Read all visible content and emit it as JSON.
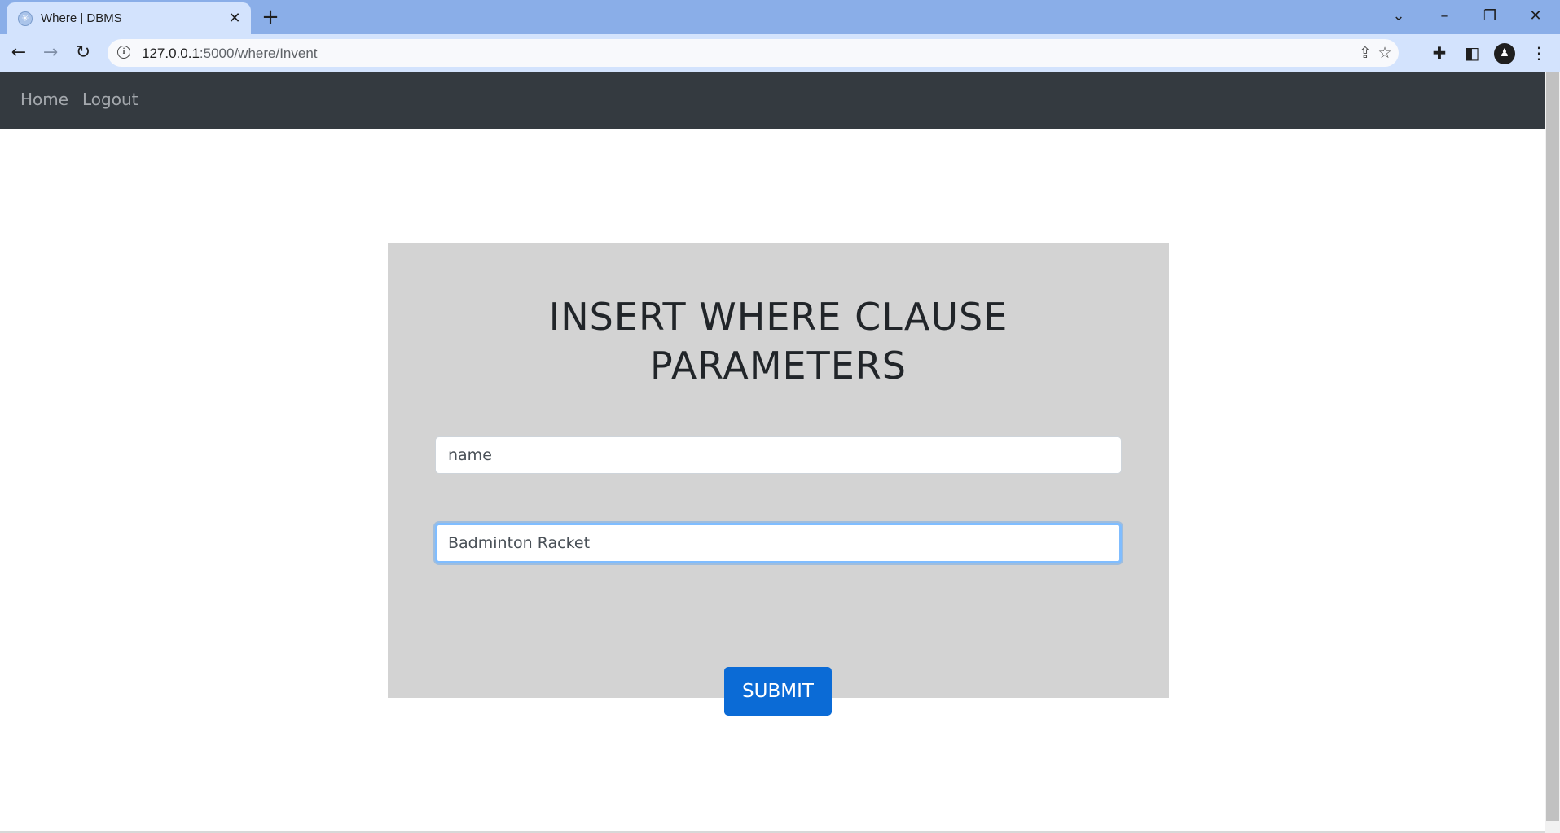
{
  "browser": {
    "tab_title": "Where | DBMS",
    "tab_favicon": "dbms-favicon",
    "url_host": "127.0.0.1",
    "url_rest": ":5000/where/Invent",
    "icons": {
      "tab_close": "close-icon",
      "new_tab": "plus-icon",
      "tab_search": "chevron-down-icon",
      "minimize": "minimize-icon",
      "restore": "restore-icon",
      "close_window": "close-icon",
      "back": "back-arrow-icon",
      "forward": "forward-arrow-icon",
      "reload": "reload-icon",
      "site_info": "info-icon",
      "share": "share-icon",
      "bookmark": "star-icon",
      "extensions": "puzzle-icon",
      "side_panel": "side-panel-icon",
      "profile": "avatar",
      "menu": "kebab-menu-icon"
    }
  },
  "navbar": {
    "links": [
      "Home",
      "Logout"
    ]
  },
  "form": {
    "title": "INSERT WHERE CLAUSE PARAMETERS",
    "column_field": {
      "value": "name",
      "placeholder": ""
    },
    "value_field": {
      "value": "Badminton Racket",
      "placeholder": ""
    },
    "submit_label": "SUBMIT"
  },
  "colors": {
    "navbar_bg": "#343a40",
    "card_bg": "#d3d3d3",
    "button_bg": "#0b6bd6",
    "focus_ring": "#80bdff",
    "tabstrip_bg": "#8aaee8",
    "toolbar_bg": "#d3e3fd"
  }
}
